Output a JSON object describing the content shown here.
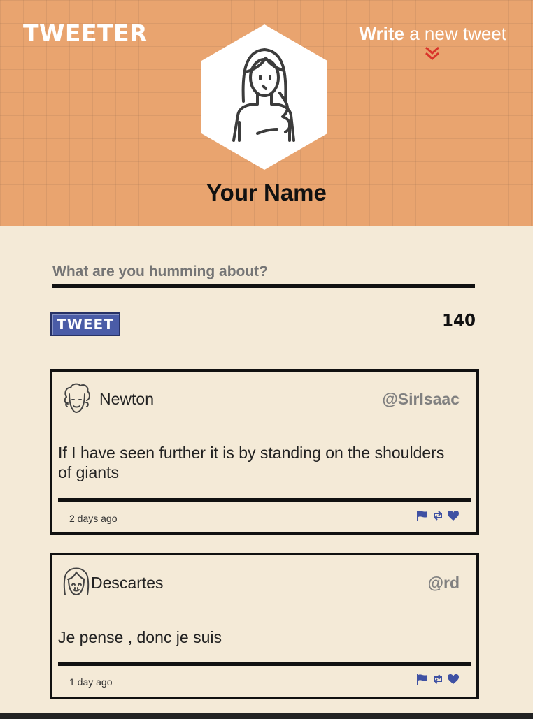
{
  "header": {
    "brand": "TWEETER",
    "compose_link_strong": "Write",
    "compose_link_rest": " a new tweet",
    "user_name": "Your Name"
  },
  "composer": {
    "placeholder": "What are you humming about?",
    "button_label": "TWEET",
    "counter": "140"
  },
  "tweets": [
    {
      "author": "Newton",
      "handle": "@SirIsaac",
      "text": "If I have seen further it is by standing on the shoulders of giants",
      "time": "2 days ago"
    },
    {
      "author": "Descartes",
      "handle": "@rd",
      "text": "Je pense , donc je suis",
      "time": "1 day ago"
    }
  ],
  "colors": {
    "header_bg": "#e9a46f",
    "page_bg": "#f4ead7",
    "accent_blue": "#4a5ca7",
    "chevron_red": "#d9342b"
  },
  "icons": [
    "avatar-icon",
    "chevron-down-icon",
    "flag-icon",
    "retweet-icon",
    "heart-icon"
  ]
}
